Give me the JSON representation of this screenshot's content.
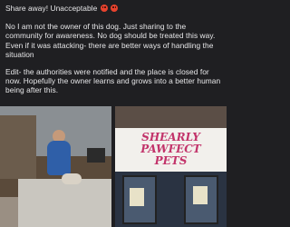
{
  "post": {
    "line1": "Share away! Unacceptable",
    "line1_emojis": [
      "angry-face-icon",
      "angry-face-icon"
    ],
    "paragraph2": "No I am not the owner of this dog.  Just sharing to the community for awareness. No dog should be treated this way.  Even if it was attacking- there are better ways of handling the situation",
    "paragraph3": "Edit- the authorities were notified and the place is closed for now. Hopefully the owner learns and grows into a better human being after this."
  },
  "images": {
    "right_sign_text_line1": "SHEARLY PAWFECT",
    "right_sign_text_line2": "PETS"
  },
  "colors": {
    "background": "#1f1f22",
    "text": "#e7e7e9",
    "emoji": "#e8432e",
    "sign_text": "#c2336a"
  }
}
